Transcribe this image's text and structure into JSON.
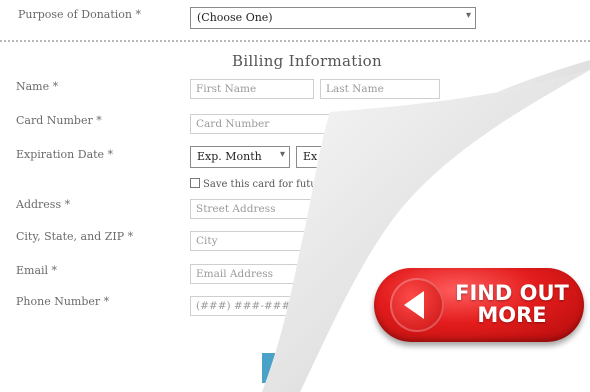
{
  "purpose": {
    "label": "Purpose of Donation *",
    "value": "(Choose One)"
  },
  "billing": {
    "title": "Billing Information",
    "name_label": "Name *",
    "first_name_placeholder": "First Name",
    "last_name_placeholder": "Last Name",
    "card_label": "Card Number *",
    "card_placeholder": "Card Number",
    "exp_label": "Expiration Date *",
    "exp_month": "Exp. Month",
    "exp_year": "Ex",
    "save_card": "Save this card for future",
    "address_label": "Address *",
    "address_placeholder": "Street Address",
    "city_label": "City, State, and ZIP *",
    "city_placeholder": "City",
    "email_label": "Email *",
    "email_placeholder": "Email Address",
    "phone_label": "Phone Number *",
    "phone_placeholder": "(###) ###-####"
  },
  "cta": {
    "line1": "FIND OUT",
    "line2": "MORE",
    "color": "#e31c1c"
  },
  "accent_submit_color": "#4aa2c8"
}
